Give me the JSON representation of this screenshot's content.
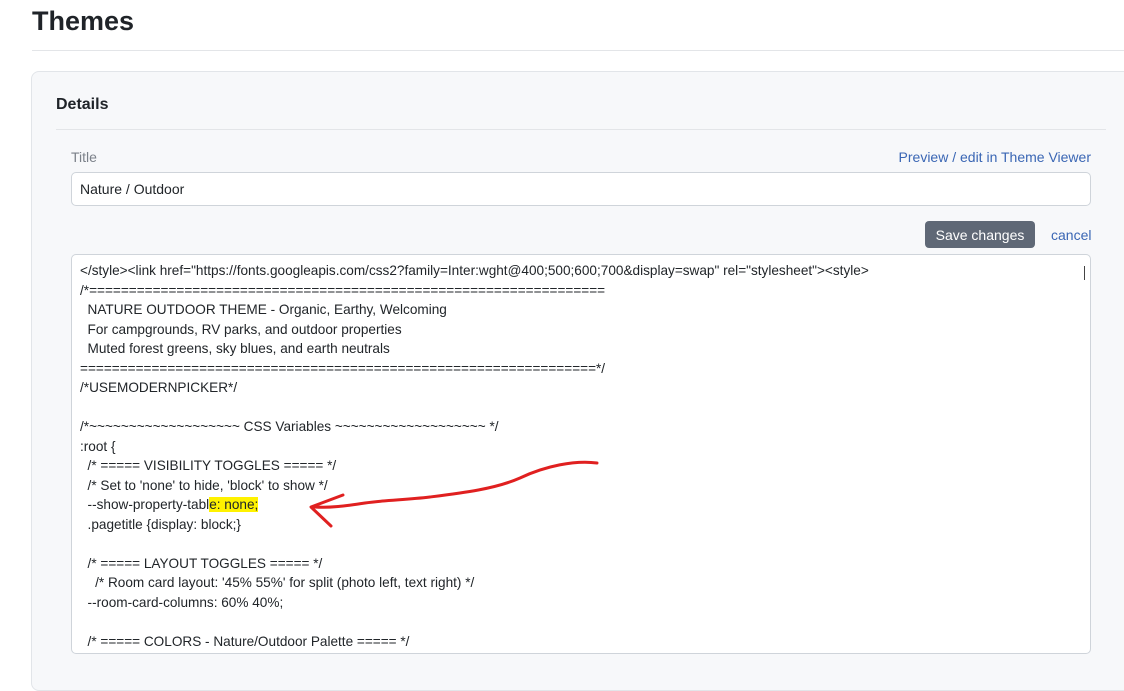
{
  "page": {
    "title": "Themes"
  },
  "details": {
    "heading": "Details",
    "title_label": "Title",
    "viewer_link": "Preview / edit in Theme Viewer",
    "title_value": "Nature / Outdoor",
    "save_label": "Save changes",
    "cancel_label": "cancel"
  },
  "code": {
    "lines": [
      "</style><link href=\"https://fonts.googleapis.com/css2?family=Inter:wght@400;500;600;700&display=swap\" rel=\"stylesheet\"><style>",
      "/*=================================================================",
      "  NATURE OUTDOOR THEME - Organic, Earthy, Welcoming",
      "  For campgrounds, RV parks, and outdoor properties",
      "  Muted forest greens, sky blues, and earth neutrals",
      "=================================================================*/",
      "/*USEMODERNPICKER*/",
      "",
      "/*~~~~~~~~~~~~~~~~~~~ CSS Variables ~~~~~~~~~~~~~~~~~~~ */",
      ":root {",
      "  /* ===== VISIBILITY TOGGLES ===== */",
      "  /* Set to 'none' to hide, 'block' to show */",
      "",
      "  .pagetitle {display: block;}",
      "",
      "  /* ===== LAYOUT TOGGLES ===== */",
      "    /* Room card layout: '45% 55%' for split (photo left, text right) */",
      "  --room-card-columns: 60% 40%;",
      "",
      "  /* ===== COLORS - Nature/Outdoor Palette ===== */"
    ],
    "line13_prefix": "  --show-property-tabl",
    "line13_highlight": "e: none;"
  },
  "annotation": {
    "arrow_color": "#e02020",
    "highlight_color": "#fff200"
  }
}
